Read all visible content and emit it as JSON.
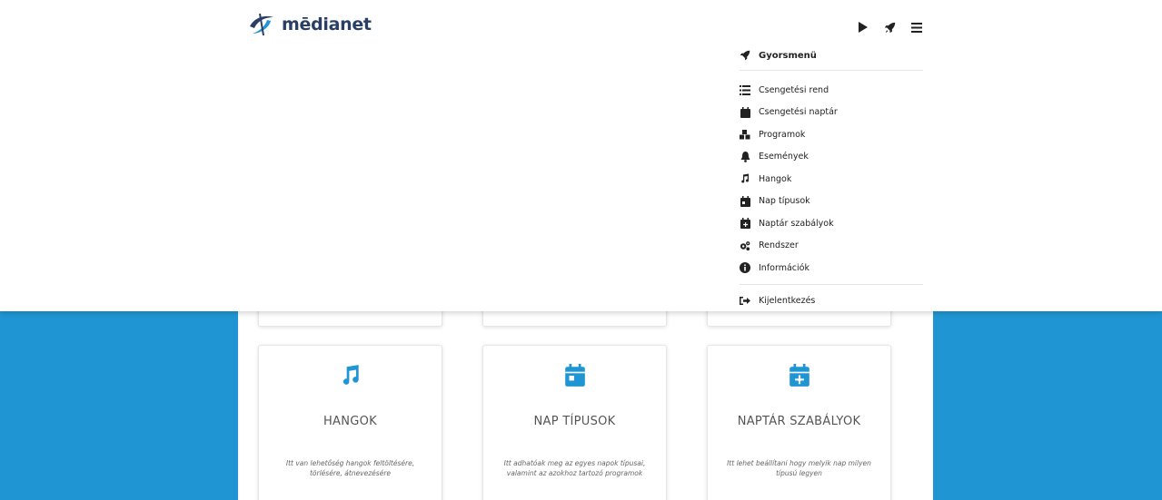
{
  "brand": {
    "name_prefix": "m",
    "name_rest": "ēdianet",
    "accent": "#1f96d3",
    "dark": "#2a3f66"
  },
  "toolbar": {
    "icons": [
      "play-icon",
      "rocket-icon",
      "menu-icon"
    ]
  },
  "quickmenu": {
    "title": "Gyorsmenü",
    "items": [
      {
        "label": "Csengetési rend",
        "icon": "list-icon"
      },
      {
        "label": "Csengetési naptár",
        "icon": "calendar-icon"
      },
      {
        "label": "Programok",
        "icon": "cubes-icon"
      },
      {
        "label": "Események",
        "icon": "bell-icon"
      },
      {
        "label": "Hangok",
        "icon": "music-icon"
      },
      {
        "label": "Nap típusok",
        "icon": "calendar-day-icon"
      },
      {
        "label": "Naptár szabályok",
        "icon": "calendar-plus-icon"
      },
      {
        "label": "Rendszer",
        "icon": "cogs-icon"
      },
      {
        "label": "Információk",
        "icon": "info-icon"
      }
    ],
    "logout": "Kijelentkezés"
  },
  "cards": [
    {
      "title": "HANGOK",
      "desc": "Itt van lehetőség hangok feltöltésére, törlésére, átnevezésére",
      "icon": "music-icon"
    },
    {
      "title": "NAP TÍPUSOK",
      "desc": "Itt adhatóak meg az egyes napok típusai, valamint az azokhoz tartozó programok",
      "icon": "calendar-day-icon"
    },
    {
      "title": "NAPTÁR SZABÁLYOK",
      "desc": "Itt lehet beállítani hogy melyik nap milyen típusú legyen",
      "icon": "calendar-plus-icon"
    }
  ]
}
